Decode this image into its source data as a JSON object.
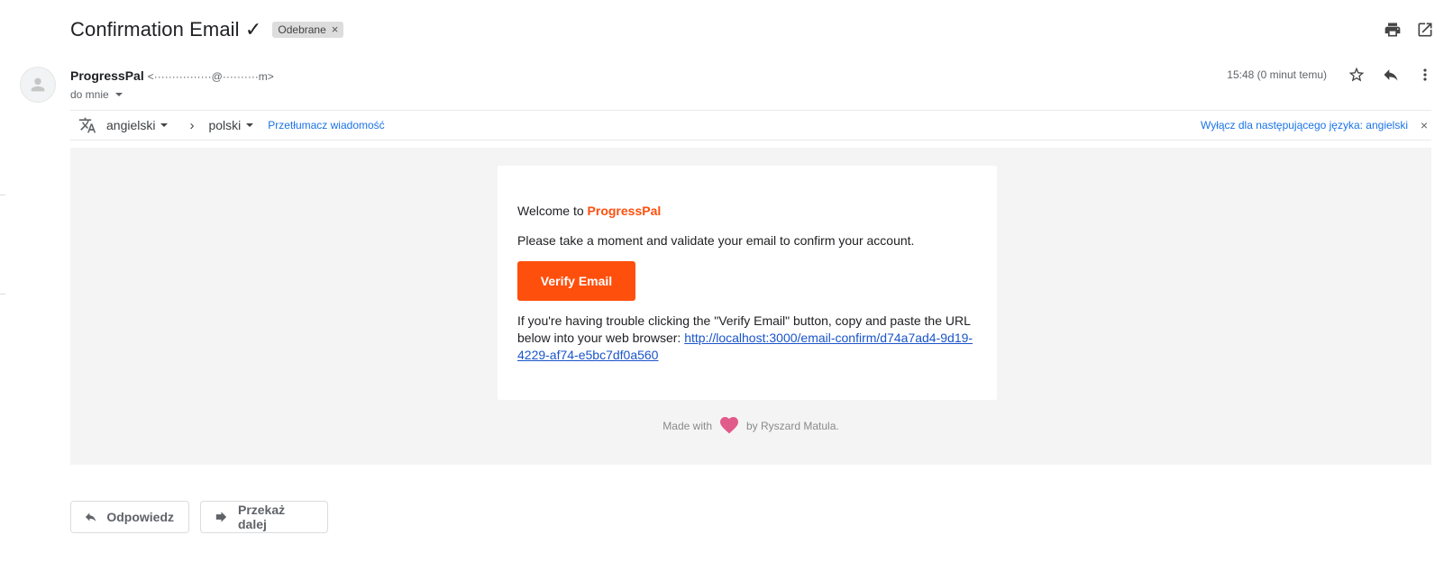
{
  "subject": {
    "title": "Confirmation Email ✓",
    "label": "Odebrane",
    "label_remove": "×"
  },
  "sender": {
    "name": "ProgressPal",
    "email": "<················@··········m>",
    "recipient": "do mnie",
    "timestamp": "15:48 (0 minut temu)"
  },
  "translate": {
    "from_lang": "angielski",
    "to_lang": "polski",
    "separator": "›",
    "translate_link": "Przetłumacz wiadomość",
    "disable_link": "Wyłącz dla następującego języka: angielski",
    "close": "×"
  },
  "email_content": {
    "welcome_prefix": "Welcome to ",
    "brand": "ProgressPal",
    "instruction": "Please take a moment and validate your email to confirm your account.",
    "button_label": "Verify Email",
    "trouble_text": "If you're having trouble clicking the \"Verify Email\" button, copy and paste the URL below into your web browser: ",
    "confirm_url": "http://localhost:3000/email-confirm/d74a7ad4-9d19-4229-af74-e5bc7df0a560",
    "footer_prefix": "Made with",
    "footer_suffix": "by Ryszard Matula."
  },
  "actions": {
    "reply": "Odpowiedz",
    "forward": "Przekaż dalej"
  },
  "colors": {
    "brand_orange": "#ff4f0c",
    "link_blue": "#1a73e8",
    "heart_pink": "#e05a8a"
  }
}
